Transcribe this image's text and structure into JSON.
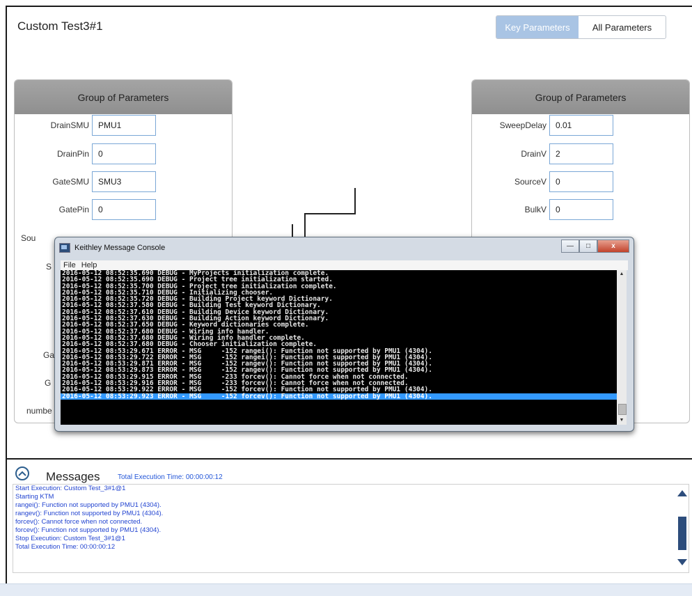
{
  "title": "Custom Test3#1",
  "toggle": {
    "key": "Key Parameters",
    "all": "All Parameters",
    "selected": "Key Parameters"
  },
  "left_group": {
    "header": "Group of Parameters",
    "params": [
      {
        "label": "DrainSMU",
        "value": "PMU1"
      },
      {
        "label": "DrainPin",
        "value": "0"
      },
      {
        "label": "GateSMU",
        "value": "SMU3"
      },
      {
        "label": "GatePin",
        "value": "0"
      }
    ],
    "partial": [
      "Sou",
      "S",
      "Ga",
      "G",
      "numbe"
    ]
  },
  "right_group": {
    "header": "Group of Parameters",
    "params": [
      {
        "label": "SweepDelay",
        "value": "0.01"
      },
      {
        "label": "DrainV",
        "value": "2"
      },
      {
        "label": "SourceV",
        "value": "0"
      },
      {
        "label": "BulkV",
        "value": "0"
      }
    ]
  },
  "console": {
    "title": "Keithley Message Console",
    "menu": [
      "File",
      "Help"
    ],
    "buttons": {
      "minimize": "—",
      "maximize": "□",
      "close": "x"
    },
    "lines": [
      "2016-05-12 08:52:35.690 DEBUG - MyProjects initialization complete.",
      "2016-05-12 08:52:35.690 DEBUG - Project tree initialization started.",
      "2016-05-12 08:52:35.700 DEBUG - Project tree initialization complete.",
      "2016-05-12 08:52:35.710 DEBUG - Initializing chooser.",
      "2016-05-12 08:52:35.720 DEBUG - Building Project keyword Dictionary.",
      "2016-05-12 08:52:37.580 DEBUG - Building Test keyword Dictionary.",
      "2016-05-12 08:52:37.610 DEBUG - Building Device keyword Dictionary.",
      "2016-05-12 08:52:37.630 DEBUG - Building Action keyword Dictionary.",
      "2016-05-12 08:52:37.650 DEBUG - Keyword dictionaries complete.",
      "2016-05-12 08:52:37.680 DEBUG - Wiring info handler.",
      "2016-05-12 08:52:37.680 DEBUG - Wiring info handler complete.",
      "2016-05-12 08:52:37.680 DEBUG - Chooser initialization complete.",
      "2016-05-12 08:53:29.671 ERROR - MSG     -152 rangei(): Function not supported by PMU1 (4304).",
      "2016-05-12 08:53:29.722 ERROR - MSG     -152 rangei(): Function not supported by PMU1 (4304).",
      "2016-05-12 08:53:29.871 ERROR - MSG     -152 rangev(): Function not supported by PMU1 (4304).",
      "2016-05-12 08:53:29.873 ERROR - MSG     -152 rangev(): Function not supported by PMU1 (4304).",
      "2016-05-12 08:53:29.915 ERROR - MSG     -233 forcev(): Cannot force when not connected.",
      "2016-05-12 08:53:29.916 ERROR - MSG     -233 forcev(): Cannot force when not connected.",
      "2016-05-12 08:53:29.922 ERROR - MSG     -152 forcev(): Function not supported by PMU1 (4304).",
      "2016-05-12 08:53:29.923 ERROR - MSG     -152 forcev(): Function not supported by PMU1 (4304)."
    ]
  },
  "messages": {
    "title": "Messages",
    "total_time_label": "Total Execution Time: 00:00:00:12",
    "lines": [
      "Start Execution: Custom Test_3#1@1",
      "Starting KTM",
      "rangei(): Function not supported by PMU1 (4304).",
      "rangev(): Function not supported by PMU1 (4304).",
      "forcev(): Cannot force when not connected.",
      "forcev(): Function not supported by PMU1 (4304).",
      "Stop Execution:  Custom Test_3#1@1",
      "Total Execution Time: 00:00:00:12"
    ]
  },
  "colors": {
    "accent": "#a9c4e4",
    "message_text": "#2143d0",
    "console_bg": "#000000",
    "selected_line": "#3399ff"
  }
}
